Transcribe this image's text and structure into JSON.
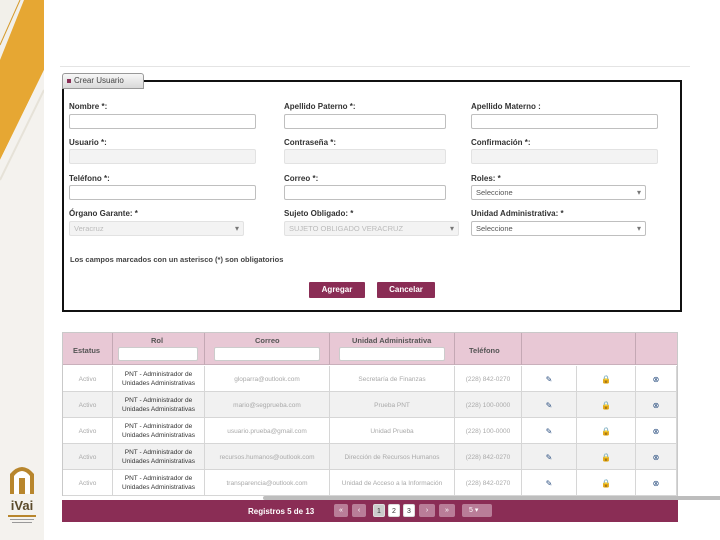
{
  "colors": {
    "brand": "#8a2d55",
    "header_bg": "#e8c8d5",
    "accent_gold": "#e6a733"
  },
  "form": {
    "tab_label": "Crear Usuario",
    "fields": [
      {
        "label": "Nombre *:",
        "value": "",
        "kind": "text"
      },
      {
        "label": "Apellido Paterno *:",
        "value": "",
        "kind": "text"
      },
      {
        "label": "Apellido Materno :",
        "value": "",
        "kind": "text"
      },
      {
        "label": "Usuario *:",
        "value": "",
        "kind": "text"
      },
      {
        "label": "Contraseña *:",
        "value": "",
        "kind": "text"
      },
      {
        "label": "Confirmación *:",
        "value": "",
        "kind": "text"
      },
      {
        "label": "Teléfono *:",
        "value": "",
        "kind": "text"
      },
      {
        "label": "Correo *:",
        "value": "",
        "kind": "text"
      },
      {
        "label": "Roles: *",
        "value": "Seleccione",
        "kind": "select"
      },
      {
        "label": "Órgano Garante: *",
        "value": "Veracruz",
        "kind": "select"
      },
      {
        "label": "Sujeto Obligado: *",
        "value": "SUJETO OBLIGADO VERACRUZ",
        "kind": "select"
      },
      {
        "label": "Unidad Administrativa: *",
        "value": "Seleccione",
        "kind": "select"
      }
    ],
    "required_note": "Los campos marcados con un asterisco (*) son obligatorios",
    "add_button": "Agregar",
    "cancel_button": "Cancelar"
  },
  "table": {
    "headers": {
      "estatus": "Estatus",
      "rol": "Rol",
      "correo": "Correo",
      "unidad": "Unidad Administrativa",
      "telefono": "Teléfono"
    },
    "rows": [
      {
        "estatus": "Activo",
        "rol": "PNT - Administrador de Unidades Administrativas",
        "correo": "gloparra@outlook.com",
        "unidad": "Secretaría de Finanzas",
        "telefono": "(228) 842-0270"
      },
      {
        "estatus": "Activo",
        "rol": "PNT - Administrador de Unidades Administrativas",
        "correo": "mario@segprueba.com",
        "unidad": "Prueba PNT",
        "telefono": "(228) 100-0000"
      },
      {
        "estatus": "Activo",
        "rol": "PNT - Administrador de Unidades Administrativas",
        "correo": "usuario.prueba@gmail.com",
        "unidad": "Unidad Prueba",
        "telefono": "(228) 100-0000"
      },
      {
        "estatus": "Activo",
        "rol": "PNT - Administrador de Unidades Administrativas",
        "correo": "recursos.humanos@outlook.com",
        "unidad": "Dirección de Recursos Humanos",
        "telefono": "(228) 842-0270"
      },
      {
        "estatus": "Activo",
        "rol": "PNT - Administrador de Unidades Administrativas",
        "correo": "transparencia@outlook.com",
        "unidad": "Unidad de Acceso a la Información",
        "telefono": "(228) 842-0270"
      }
    ],
    "footer": {
      "records_label": "Registros 5 de 13",
      "pages": [
        "1",
        "2",
        "3"
      ],
      "first": "«",
      "prev": "‹",
      "next": "›",
      "last": "»",
      "page_size": "5"
    }
  },
  "logo": {
    "text": "iVai"
  }
}
